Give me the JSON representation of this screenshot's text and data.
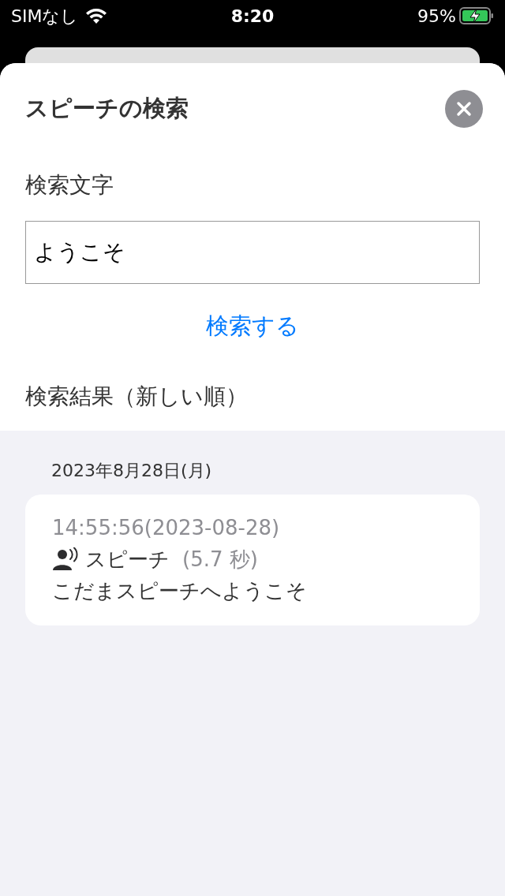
{
  "status_bar": {
    "carrier": "SIMなし",
    "time": "8:20",
    "battery": "95%",
    "charging": true
  },
  "sheet": {
    "title": "スピーチの検索",
    "search_label": "検索文字",
    "search_field": {
      "value": "ようこそ"
    },
    "search_button": "検索する",
    "results_label": "検索結果（新しい順）"
  },
  "results": [
    {
      "date": "2023年8月28日(月)",
      "items": [
        {
          "timestamp": "14:55:56(2023-08-28)",
          "type": "スピーチ",
          "duration": "(5.7 秒)",
          "text": "こだまスピーチへようこそ"
        }
      ]
    }
  ]
}
